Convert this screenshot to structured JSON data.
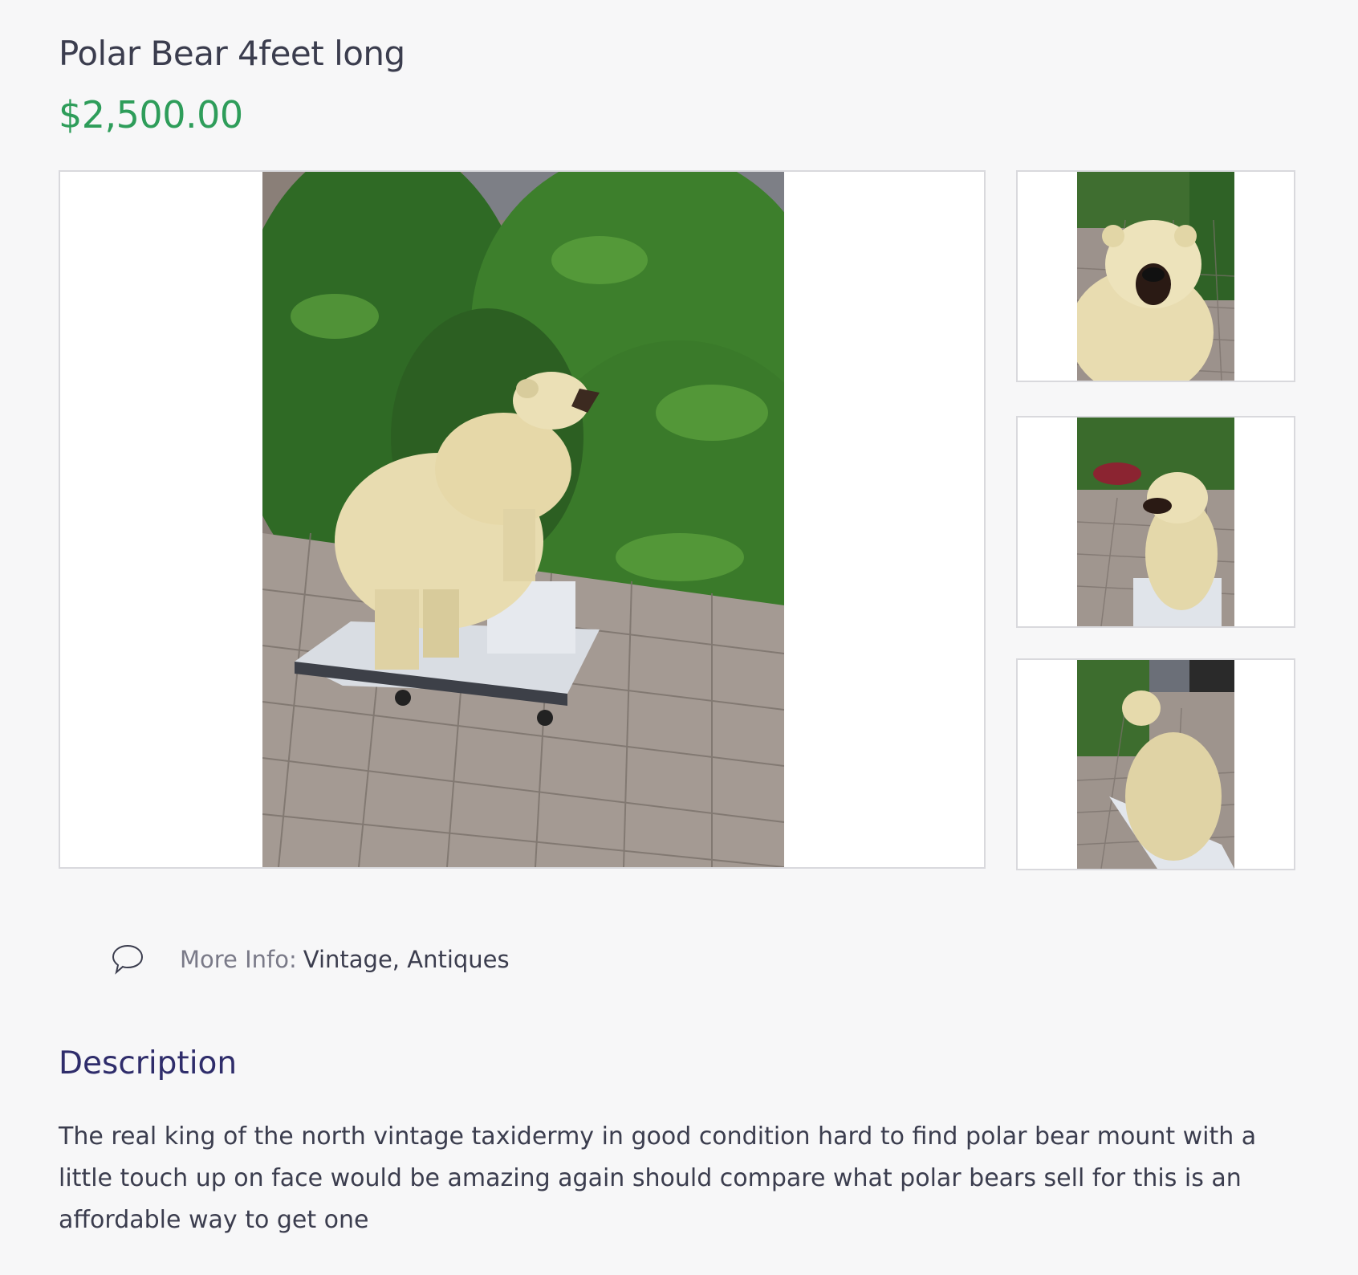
{
  "listing": {
    "title": "Polar Bear 4feet long",
    "price": "$2,500.00"
  },
  "gallery": {
    "main_image_alt": "Polar bear mount standing on white base",
    "thumbnails": [
      {
        "alt": "Polar bear close-up face"
      },
      {
        "alt": "Polar bear front view"
      },
      {
        "alt": "Polar bear rear view"
      }
    ]
  },
  "details": {
    "more_info_label": "More Info:",
    "more_info_value": "Vintage, Antiques",
    "icon": "speech-bubble-icon"
  },
  "description": {
    "heading": "Description",
    "text": "The real king of the north vintage taxidermy in good condition hard to find polar bear mount with a little touch up on face would be amazing again should compare what polar bears sell for this is an affordable way to get one"
  },
  "colors": {
    "price": "#2e9d5a",
    "heading": "#2f2d6b",
    "text": "#3b3d4e",
    "background": "#f7f7f8"
  }
}
